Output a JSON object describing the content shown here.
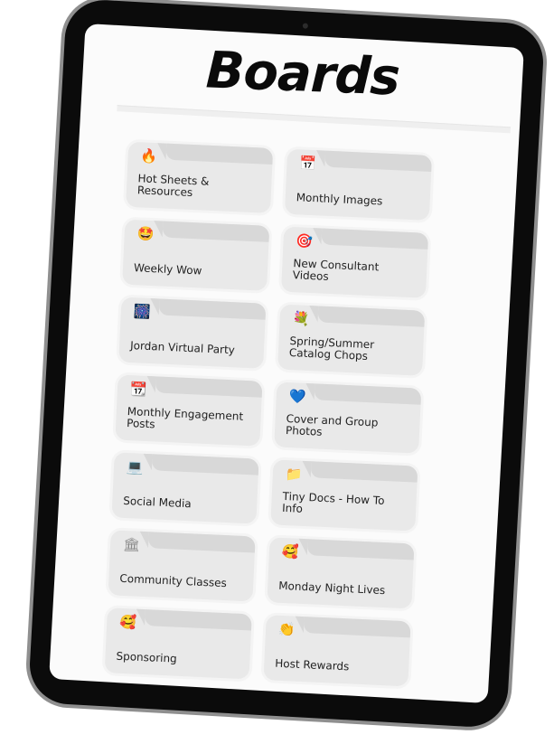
{
  "page": {
    "title": "Boards"
  },
  "boards": [
    {
      "label": "Hot Sheets & Resources",
      "icon": "fire-icon",
      "glyph": "🔥",
      "color": "#f07a1a"
    },
    {
      "label": "Monthly Images",
      "icon": "calendar-icon",
      "glyph": "📅",
      "color": "#3f7fd6"
    },
    {
      "label": "Weekly Wow",
      "icon": "star-struck-face-icon",
      "glyph": "🤩",
      "color": "#e0395f"
    },
    {
      "label": "New Consultant Videos",
      "icon": "target-icon",
      "glyph": "🎯",
      "color": "#d8322d"
    },
    {
      "label": "Jordan Virtual Party",
      "icon": "party-image-icon",
      "glyph": "🎆",
      "color": "#5b3fa8"
    },
    {
      "label": "Spring/Summer Catalog Chops",
      "icon": "flower-bouquet-icon",
      "glyph": "💐",
      "color": "#e04b7a"
    },
    {
      "label": "Monthly Engagement Posts",
      "icon": "calendar-icon",
      "glyph": "📆",
      "color": "#3f7fd6"
    },
    {
      "label": "Cover and Group Photos",
      "icon": "blue-heart-icon",
      "glyph": "💙",
      "color": "#2f6fd1"
    },
    {
      "label": "Social Media",
      "icon": "laptop-icon",
      "glyph": "💻",
      "color": "#3b86d6"
    },
    {
      "label": "Tiny Docs - How To Info",
      "icon": "folder-icon",
      "glyph": "📁",
      "color": "#f2b31a"
    },
    {
      "label": "Community Classes",
      "icon": "classical-building-icon",
      "glyph": "🏛",
      "color": "#8a8a8a"
    },
    {
      "label": "Monday Night Lives",
      "icon": "smiling-face-with-hearts-icon",
      "glyph": "🥰",
      "color": "#e8a21a"
    },
    {
      "label": "Sponsoring",
      "icon": "smiling-face-with-hearts-icon",
      "glyph": "🥰",
      "color": "#e8a21a"
    },
    {
      "label": "Host Rewards",
      "icon": "clapping-hands-icon",
      "glyph": "👏",
      "color": "#e6a93a"
    }
  ]
}
